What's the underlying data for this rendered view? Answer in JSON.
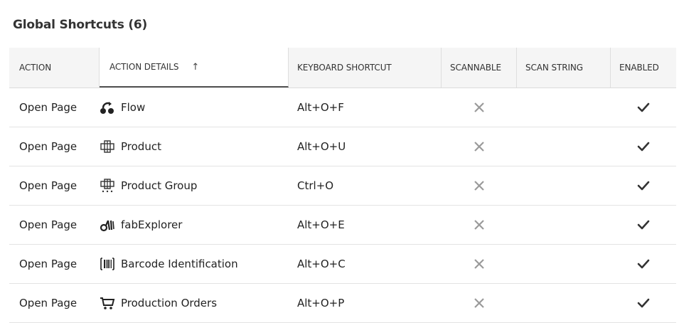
{
  "panel": {
    "title": "Global Shortcuts (6)"
  },
  "columns": {
    "action": "ACTION",
    "action_details": "ACTION DETAILS",
    "keyboard_shortcut": "KEYBOARD SHORTCUT",
    "scannable": "SCANNABLE",
    "scan_string": "SCAN STRING",
    "enabled": "ENABLED",
    "sort_indicator": "↑"
  },
  "rows": [
    {
      "action": "Open Page",
      "details": "Flow",
      "icon": "flow-icon",
      "shortcut": "Alt+O+F",
      "scannable": false,
      "scan_string": "",
      "enabled": true
    },
    {
      "action": "Open Page",
      "details": "Product",
      "icon": "product-icon",
      "shortcut": "Alt+O+U",
      "scannable": false,
      "scan_string": "",
      "enabled": true
    },
    {
      "action": "Open Page",
      "details": "Product Group",
      "icon": "product-group-icon",
      "shortcut": "Ctrl+O",
      "scannable": false,
      "scan_string": "",
      "enabled": true
    },
    {
      "action": "Open Page",
      "details": "fabExplorer",
      "icon": "fab-explorer-icon",
      "shortcut": "Alt+O+E",
      "scannable": false,
      "scan_string": "",
      "enabled": true
    },
    {
      "action": "Open Page",
      "details": "Barcode Identification",
      "icon": "barcode-icon",
      "shortcut": "Alt+O+C",
      "scannable": false,
      "scan_string": "",
      "enabled": true
    },
    {
      "action": "Open Page",
      "details": "Production Orders",
      "icon": "cart-icon",
      "shortcut": "Alt+O+P",
      "scannable": false,
      "scan_string": "",
      "enabled": true
    }
  ],
  "colors": {
    "header_bg": "#f5f5f5",
    "cross": "#9a9a9a",
    "check": "#333333"
  }
}
